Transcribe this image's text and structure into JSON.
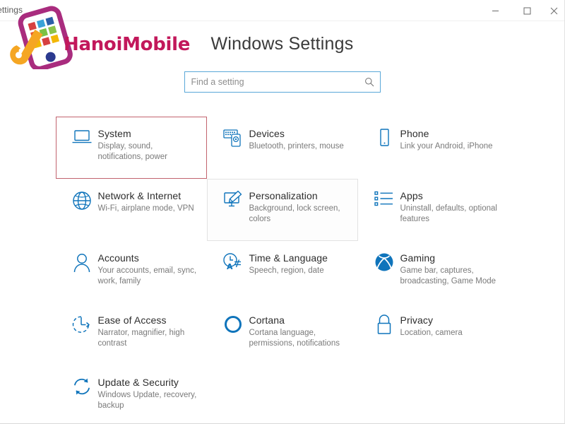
{
  "window": {
    "title": "Settings",
    "controls": [
      {
        "name": "minimize-button",
        "label": "Minimize"
      },
      {
        "name": "maximize-button",
        "label": "Maximize"
      },
      {
        "name": "close-button",
        "label": "Close"
      }
    ]
  },
  "header": {
    "page_title": "Windows Settings"
  },
  "search": {
    "placeholder": "Find a setting",
    "value": "",
    "icon": "search-icon"
  },
  "watermark": {
    "text": "HanoiMobile",
    "brand_color": "#c2185b",
    "phone_color": "#a92c7e",
    "wrench_color": "#f5a623",
    "tiles": [
      "#d64040",
      "#3aa3d8",
      "#e8572b",
      "#2b5fa8",
      "#7ac143",
      "#f2b705",
      "#d64040",
      "#3aa3d8",
      "#8bc34a"
    ]
  },
  "colors": {
    "accent": "#0f74bb",
    "highlight_border": "#c2636e",
    "hover_border": "#e2e2e2",
    "search_border": "#5aa7d8"
  },
  "tiles": [
    {
      "id": "system",
      "icon": "laptop-icon",
      "title": "System",
      "subtitle": "Display, sound, notifications, power",
      "state": "highlighted"
    },
    {
      "id": "devices",
      "icon": "devices-icon",
      "title": "Devices",
      "subtitle": "Bluetooth, printers, mouse",
      "state": "normal"
    },
    {
      "id": "phone",
      "icon": "phone-icon",
      "title": "Phone",
      "subtitle": "Link your Android, iPhone",
      "state": "normal"
    },
    {
      "id": "network-internet",
      "icon": "globe-icon",
      "title": "Network & Internet",
      "subtitle": "Wi-Fi, airplane mode, VPN",
      "state": "normal"
    },
    {
      "id": "personalization",
      "icon": "paintbrush-monitor-icon",
      "title": "Personalization",
      "subtitle": "Background, lock screen, colors",
      "state": "hovered"
    },
    {
      "id": "apps",
      "icon": "list-icon",
      "title": "Apps",
      "subtitle": "Uninstall, defaults, optional features",
      "state": "normal"
    },
    {
      "id": "accounts",
      "icon": "person-icon",
      "title": "Accounts",
      "subtitle": "Your accounts, email, sync, work, family",
      "state": "normal"
    },
    {
      "id": "time-language",
      "icon": "clock-language-icon",
      "title": "Time & Language",
      "subtitle": "Speech, region, date",
      "state": "normal"
    },
    {
      "id": "gaming",
      "icon": "xbox-icon",
      "title": "Gaming",
      "subtitle": "Game bar, captures, broadcasting, Game Mode",
      "state": "normal"
    },
    {
      "id": "ease-of-access",
      "icon": "ease-of-access-icon",
      "title": "Ease of Access",
      "subtitle": "Narrator, magnifier, high contrast",
      "state": "normal"
    },
    {
      "id": "cortana",
      "icon": "cortana-ring-icon",
      "title": "Cortana",
      "subtitle": "Cortana language, permissions, notifications",
      "state": "normal"
    },
    {
      "id": "privacy",
      "icon": "lock-icon",
      "title": "Privacy",
      "subtitle": "Location, camera",
      "state": "normal"
    },
    {
      "id": "update-security",
      "icon": "refresh-icon",
      "title": "Update & Security",
      "subtitle": "Windows Update, recovery, backup",
      "state": "normal"
    }
  ]
}
